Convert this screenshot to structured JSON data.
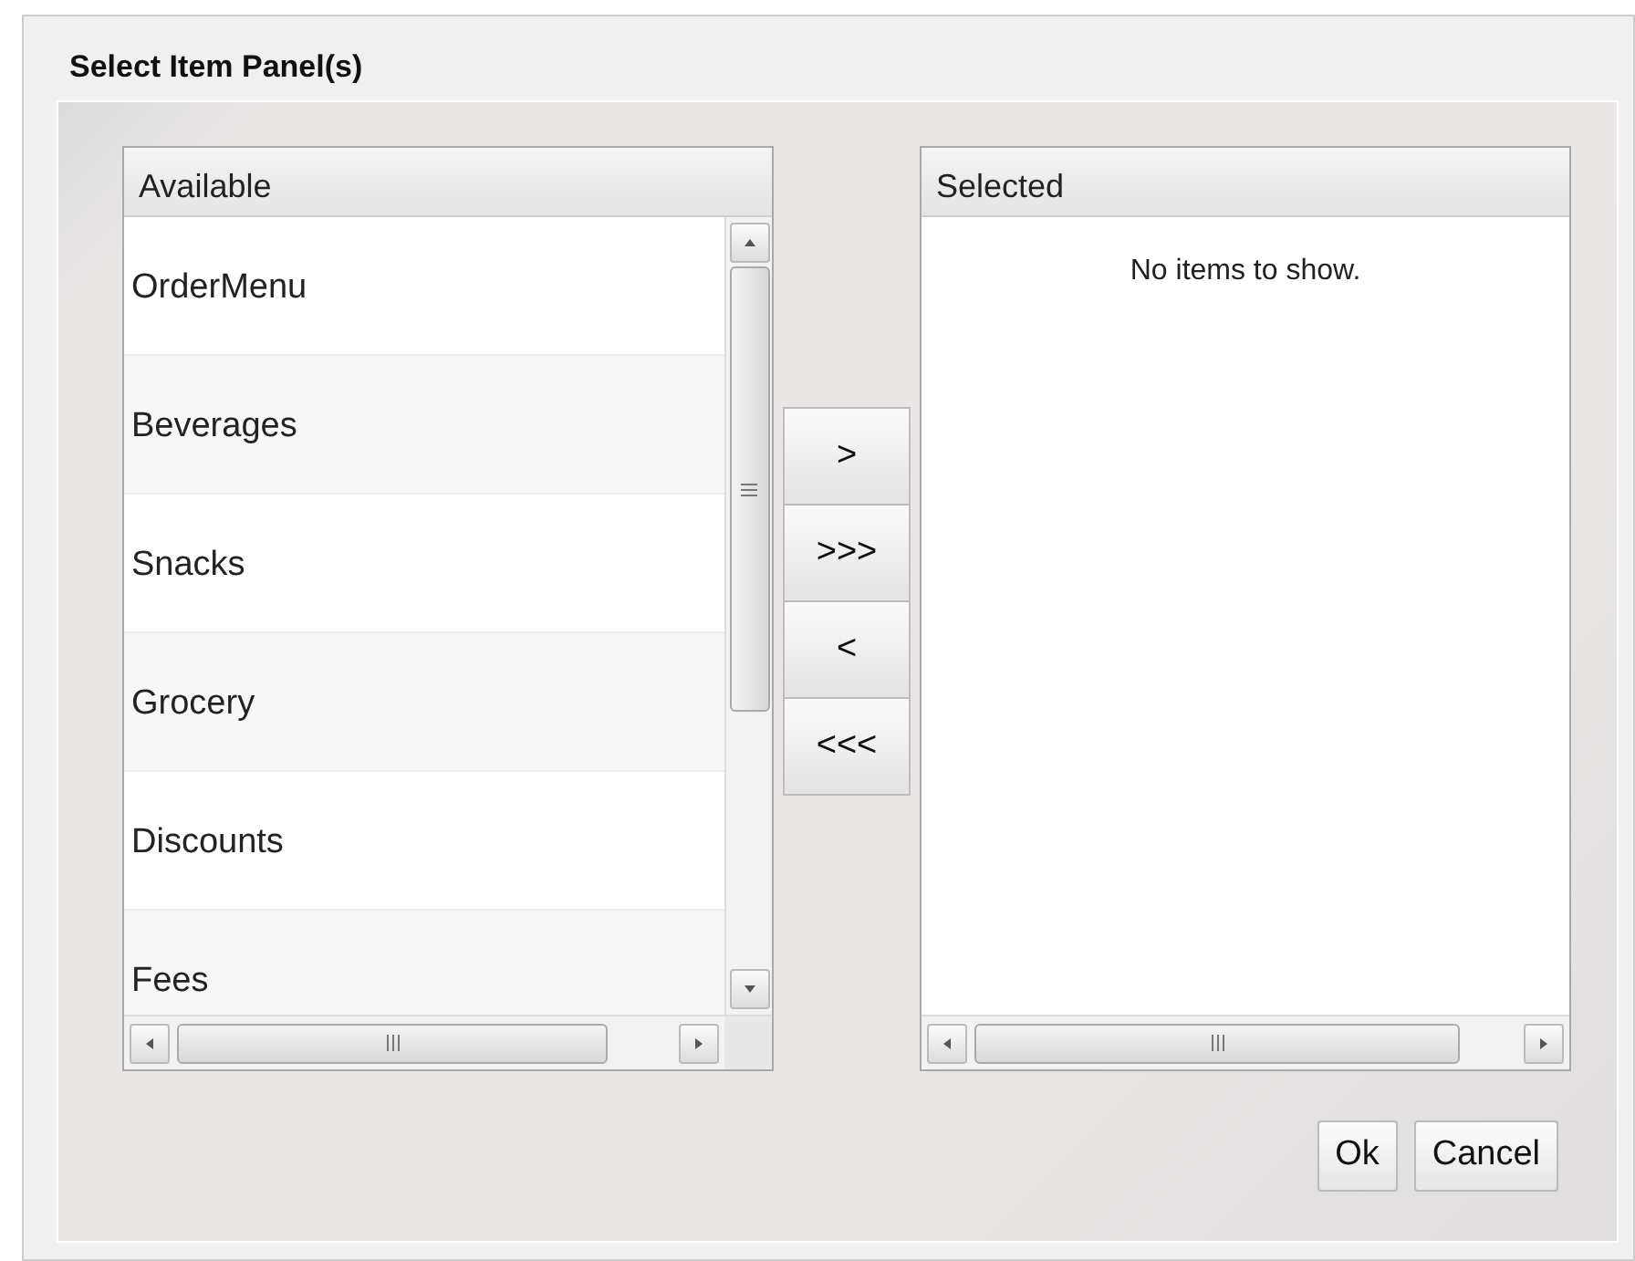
{
  "dialog": {
    "title": "Select Item Panel(s)"
  },
  "available": {
    "header": "Available",
    "items": [
      {
        "label": "OrderMenu",
        "selected": false
      },
      {
        "label": "Beverages",
        "selected": false
      },
      {
        "label": "Snacks",
        "selected": false
      },
      {
        "label": "Grocery",
        "selected": false
      },
      {
        "label": "Discounts",
        "selected": false
      },
      {
        "label": "Fees",
        "selected": false
      }
    ]
  },
  "transfer_buttons": [
    ">",
    ">>>",
    "<",
    "<<<"
  ],
  "selected": {
    "header": "Selected",
    "empty_text": "No items to show."
  },
  "buttons": [
    "Ok",
    "Cancel"
  ]
}
